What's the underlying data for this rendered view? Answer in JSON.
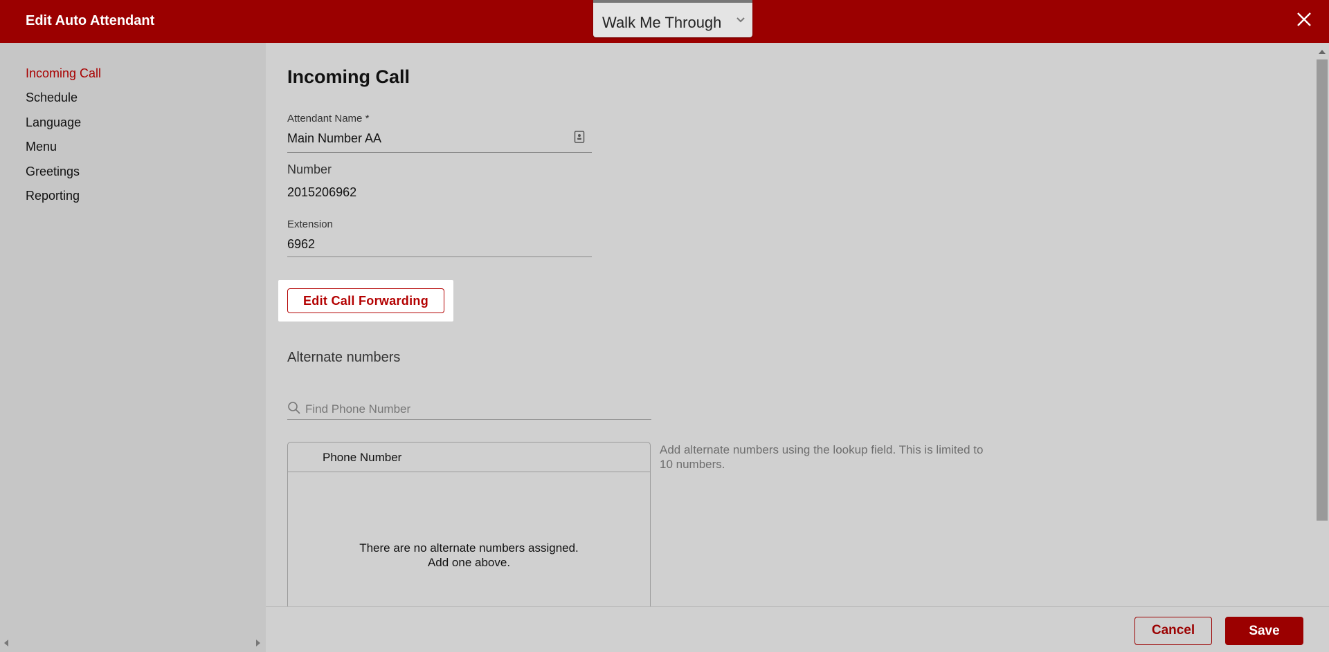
{
  "header": {
    "title": "Edit Auto Attendant",
    "walk_me_through": "Walk Me Through"
  },
  "sidebar": {
    "items": [
      {
        "label": "Incoming Call",
        "active": true
      },
      {
        "label": "Schedule",
        "active": false
      },
      {
        "label": "Language",
        "active": false
      },
      {
        "label": "Menu",
        "active": false
      },
      {
        "label": "Greetings",
        "active": false
      },
      {
        "label": "Reporting",
        "active": false
      }
    ]
  },
  "main": {
    "title": "Incoming Call",
    "attendant_name": {
      "label": "Attendant Name *",
      "value": "Main Number AA"
    },
    "number": {
      "label": "Number",
      "value": "2015206962"
    },
    "extension": {
      "label": "Extension",
      "value": "6962"
    },
    "edit_call_forwarding": "Edit Call Forwarding",
    "alternate_numbers": {
      "title": "Alternate numbers",
      "search_placeholder": "Find Phone Number",
      "table_header": "Phone Number",
      "empty_line1": "There are no alternate numbers assigned.",
      "empty_line2": "Add one above.",
      "hint": "Add alternate numbers using the lookup field. This is limited to 10 numbers."
    }
  },
  "footer": {
    "cancel": "Cancel",
    "save": "Save"
  },
  "colors": {
    "brand": "#9b0000",
    "active_nav": "#a80000",
    "sidebar_bg": "#c6c6c6",
    "content_bg": "#d0d0d0"
  }
}
